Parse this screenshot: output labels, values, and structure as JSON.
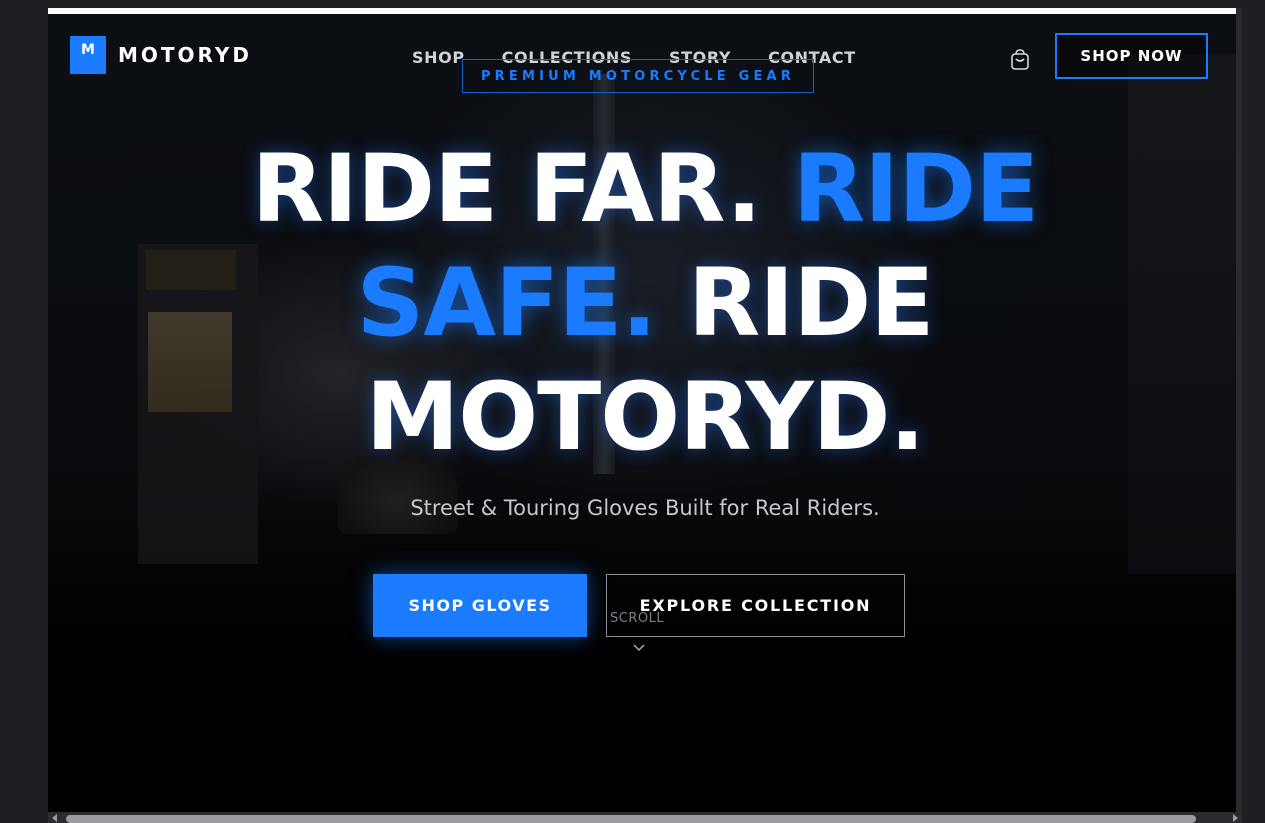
{
  "brand": {
    "logo_letter": "M",
    "name": "MOTORYD"
  },
  "nav": {
    "items": [
      {
        "label": "SHOP"
      },
      {
        "label": "COLLECTIONS"
      },
      {
        "label": "STORY"
      },
      {
        "label": "CONTACT"
      }
    ]
  },
  "tagline": "PREMIUM MOTORCYCLE GEAR",
  "header": {
    "cart_icon": "shopping-bag-icon",
    "shop_now_label": "SHOP NOW"
  },
  "hero": {
    "line1_white": "RIDE FAR. ",
    "line1_blue": "RIDE",
    "line2_blue": "SAFE.",
    "line2_white": " RIDE",
    "line3_white": "MOTORYD.",
    "subtitle": "Street & Touring Gloves Built for Real Riders."
  },
  "cta": {
    "primary_label": "SHOP GLOVES",
    "secondary_label": "EXPLORE COLLECTION"
  },
  "scroll_hint": {
    "label": "SCROLL",
    "icon": "chevron-down-icon"
  },
  "colors": {
    "accent": "#1a7bff",
    "background": "#000000",
    "text": "#ffffff"
  }
}
